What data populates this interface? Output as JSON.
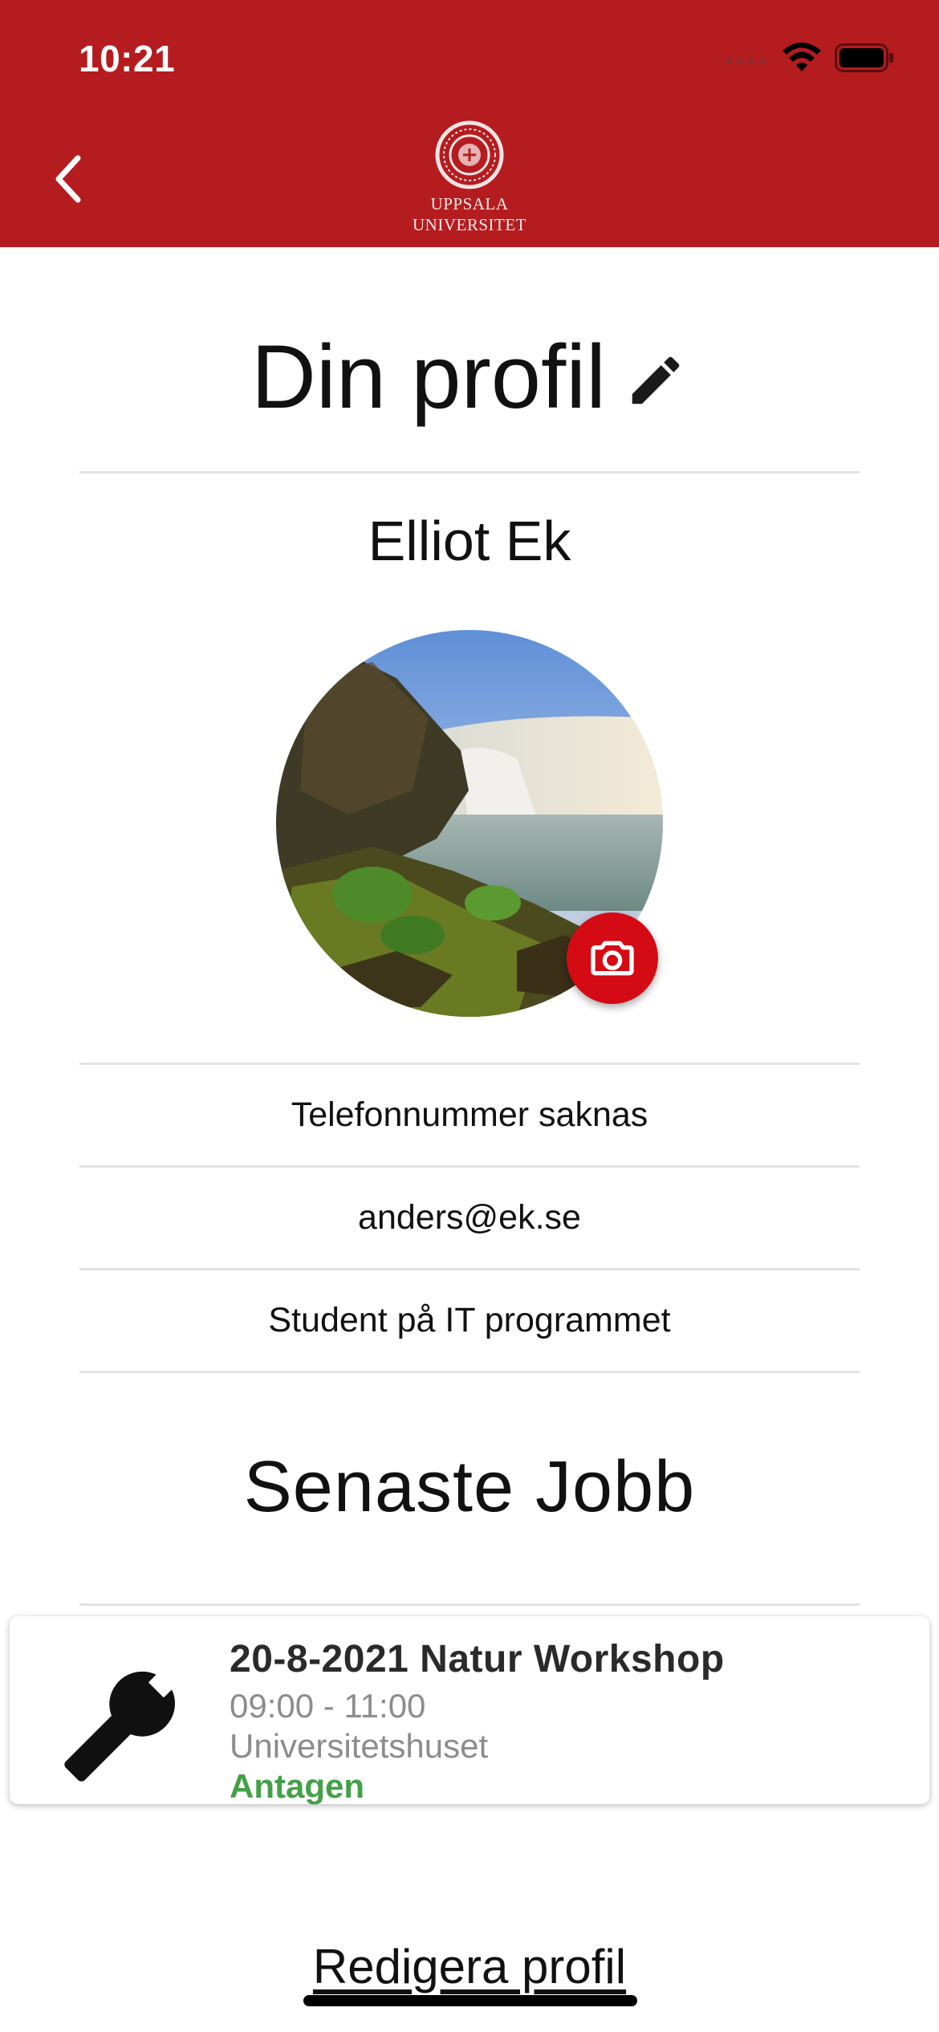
{
  "status_bar": {
    "time": "10:21"
  },
  "header": {
    "logo_line1": "UPPSALA",
    "logo_line2": "UNIVERSITET",
    "brand_color": "#b51c1f"
  },
  "profile": {
    "title": "Din profil",
    "name": "Elliot Ek",
    "phone": "Telefonnummer saknas",
    "email": "anders@ek.se",
    "description": "Student på IT programmet"
  },
  "latest_jobs": {
    "title": "Senaste Jobb",
    "items": [
      {
        "title": "20-8-2021 Natur Workshop",
        "time": "09:00 - 11:00",
        "location": "Universitetshuset",
        "status": "Antagen",
        "icon": "tools-icon",
        "status_color": "#43a047"
      }
    ]
  },
  "footer": {
    "edit_profile_label": "Redigera profil"
  },
  "icons": {
    "back": "chevron-left-icon",
    "edit": "pencil-icon",
    "camera": "camera-icon"
  }
}
